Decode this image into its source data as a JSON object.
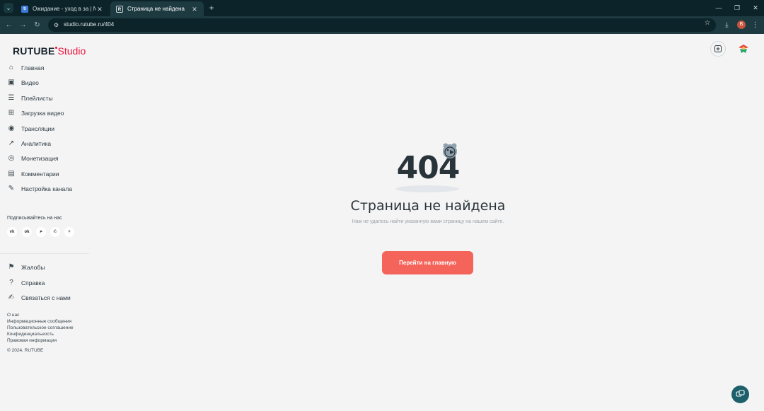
{
  "browser": {
    "tabs": [
      {
        "title": "Ожидание - уход в за | NEXTR",
        "favicon": "tab1-favicon",
        "favicon_text": "tl"
      },
      {
        "title": "Страница не найдена",
        "favicon": "rutube-favicon",
        "favicon_text": "R"
      }
    ],
    "url": "studio.rutube.ru/404",
    "profile_initial": "B"
  },
  "logo": {
    "brand": "RUTUBE",
    "product": "Studio"
  },
  "nav": [
    {
      "label": "Главная",
      "icon": "home-icon"
    },
    {
      "label": "Видео",
      "icon": "video-icon"
    },
    {
      "label": "Плейлисты",
      "icon": "playlist-icon"
    },
    {
      "label": "Загрузка видео",
      "icon": "upload-video-icon"
    },
    {
      "label": "Трансляции",
      "icon": "broadcast-icon"
    },
    {
      "label": "Аналитика",
      "icon": "analytics-icon"
    },
    {
      "label": "Монетизация",
      "icon": "monetization-icon"
    },
    {
      "label": "Комментарии",
      "icon": "comments-icon"
    },
    {
      "label": "Настройка канала",
      "icon": "channel-settings-icon"
    }
  ],
  "follow": {
    "label": "Подписывайтесь на нас",
    "socials": [
      {
        "name": "vk-icon",
        "glyph": "vk"
      },
      {
        "name": "ok-icon",
        "glyph": "ok"
      },
      {
        "name": "telegram-icon",
        "glyph": "➤"
      },
      {
        "name": "viber-icon",
        "glyph": "✆"
      },
      {
        "name": "more-icon",
        "glyph": "+"
      }
    ]
  },
  "support": [
    {
      "label": "Жалобы",
      "icon": "flag-icon"
    },
    {
      "label": "Справка",
      "icon": "help-icon"
    },
    {
      "label": "Связаться с нами",
      "icon": "contact-icon"
    }
  ],
  "footer": {
    "links": [
      "О нас",
      "Информационные сообщения",
      "Пользовательское соглашение",
      "Конфиденциальность",
      "Правовая информация"
    ],
    "copyright": "© 2024, RUTUBE"
  },
  "error": {
    "code": "404",
    "title": "Страница не найдена",
    "description": "Нам не удалось найти указанную вами страницу на нашем сайте.",
    "cta": "Перейти на главную"
  },
  "colors": {
    "accent": "#f5645a",
    "brand_red": "#ed143b",
    "chrome_dark": "#0b2329",
    "chat_fab": "#1d5f6a"
  }
}
